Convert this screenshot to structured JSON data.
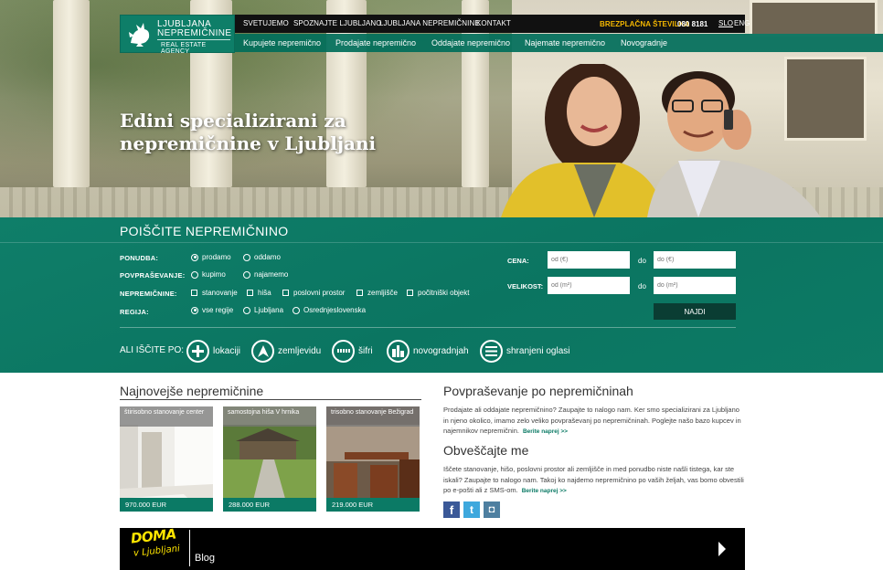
{
  "brand": {
    "line1": "LJUBLJANA",
    "line2": "NEPREMIČNINE",
    "line3": "REAL ESTATE AGENCY"
  },
  "top_nav": [
    "SVETUJEMO",
    "SPOZNAJTE LJUBLJANO",
    "LJUBLJANA NEPREMIČNINE",
    "KONTAKT"
  ],
  "free_phone": {
    "label": "BREZPLAČNA ŠTEVILKA",
    "number": "080 8181"
  },
  "languages": [
    {
      "code": "SLO",
      "active": true
    },
    {
      "code": "ENG",
      "active": false
    }
  ],
  "sub_nav": [
    "Kupujete nepremično",
    "Prodajate nepremično",
    "Oddajate nepremično",
    "Najemate nepremično",
    "Novogradnje"
  ],
  "hero": {
    "line1": "Edini specializirani za",
    "line2": "nepremičnine v Ljubljani"
  },
  "search": {
    "title": "POIŠČITE NEPREMIČNINO",
    "ponudba": {
      "label": "PONUDBA:",
      "options": [
        {
          "text": "prodamo",
          "checked": true
        },
        {
          "text": "oddamo",
          "checked": false
        }
      ]
    },
    "povprasevanje": {
      "label": "POVPRAŠEVANJE:",
      "options": [
        {
          "text": "kupimo",
          "checked": false
        },
        {
          "text": "najamemo",
          "checked": false
        }
      ]
    },
    "nepremicnine": {
      "label": "NEPREMIČNINE:",
      "options": [
        {
          "text": "stanovanje",
          "checked": false
        },
        {
          "text": "hiša",
          "checked": false
        },
        {
          "text": "poslovni prostor",
          "checked": false
        },
        {
          "text": "zemljišče",
          "checked": false
        },
        {
          "text": "počitniški objekt",
          "checked": false
        }
      ]
    },
    "regija": {
      "label": "REGIJA:",
      "options": [
        {
          "text": "vse regije",
          "checked": true
        },
        {
          "text": "Ljubljana",
          "checked": false
        },
        {
          "text": "Osrednjeslovenska",
          "checked": false
        }
      ]
    },
    "cena": {
      "label": "CENA:",
      "from_placeholder": "od (€)",
      "to_label": "do",
      "to_placeholder": "do (€)"
    },
    "velikost": {
      "label": "VELIKOST:",
      "from_placeholder": "od (m²)",
      "to_label": "do",
      "to_placeholder": "do (m²)"
    },
    "submit": "NAJDI",
    "alt_label": "ALI IŠČITE PO:",
    "alt_links": [
      {
        "text": "lokaciji",
        "icon": "plus-icon"
      },
      {
        "text": "zemljevidu",
        "icon": "map-pin-icon"
      },
      {
        "text": "šifri",
        "icon": "code-icon"
      },
      {
        "text": "novogradnjah",
        "icon": "building-icon"
      },
      {
        "text": "shranjeni oglasi",
        "icon": "saved-list-icon"
      }
    ]
  },
  "latest": {
    "title": "Najnovejše nepremičnine",
    "cards": [
      {
        "caption": "štirisobno stanovanje center",
        "price": "970.000 EUR"
      },
      {
        "caption": "samostojna hiša V hrnika",
        "price": "288.000 EUR"
      },
      {
        "caption": "trisobno stanovanje Bežigrad",
        "price": "219.000 EUR"
      }
    ]
  },
  "inquiry": {
    "title": "Povpraševanje po nepremičninah",
    "text": "Prodajate ali oddajate nepremičnino? Zaupajte to nalogo nam. Ker smo specializirani za Ljubljano in njeno okolico, imamo zelo  veliko povpraševanj po nepremičninah. Poglejte našo bazo kupcev in najemnikov nepremičnin.",
    "more": "Berite naprej >>"
  },
  "notify": {
    "title": "Obveščajte me",
    "text": "Iščete stanovanje, hišo, poslovni prostor ali zemljišče in med ponudbo niste našli tistega, kar ste iskali? Zaupajte to nalogo nam. Takoj ko najdemo nepremičnino po vaših željah, vas bomo obvestili po e-pošti ali z SMS-om.",
    "more": "Berite naprej >>"
  },
  "social": [
    {
      "name": "facebook",
      "glyph": "f",
      "color": "#3b5998"
    },
    {
      "name": "twitter",
      "glyph": "t",
      "color": "#3ea8dd"
    },
    {
      "name": "instagram",
      "glyph": "◘",
      "color": "#4e7fa0"
    }
  ],
  "blog": {
    "logo_top": "DOMA",
    "logo_bottom": "v Ljubljani",
    "label": "Blog"
  }
}
